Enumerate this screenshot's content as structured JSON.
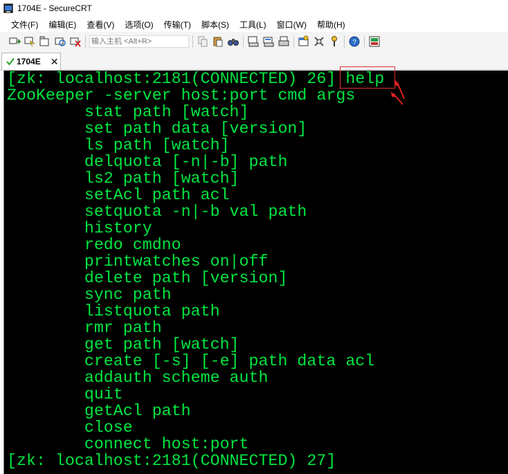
{
  "window": {
    "title": "1704E - SecureCRT"
  },
  "menu": [
    "文件(F)",
    "编辑(E)",
    "查看(V)",
    "选项(O)",
    "传输(T)",
    "脚本(S)",
    "工具(L)",
    "窗口(W)",
    "帮助(H)"
  ],
  "toolbar": {
    "quick_connect_placeholder": "输入主机 <Alt+R>"
  },
  "tab": {
    "label": "1704E",
    "close": "✕"
  },
  "terminal": {
    "text_color": "#00e640",
    "lines": [
      "[zk: localhost:2181(CONNECTED) 26] help",
      "ZooKeeper -server host:port cmd args",
      "        stat path [watch]",
      "        set path data [version]",
      "        ls path [watch]",
      "        delquota [-n|-b] path",
      "        ls2 path [watch]",
      "        setAcl path acl",
      "        setquota -n|-b val path",
      "        history",
      "        redo cmdno",
      "        printwatches on|off",
      "        delete path [version]",
      "        sync path",
      "        listquota path",
      "        rmr path",
      "        get path [watch]",
      "        create [-s] [-e] path data acl",
      "        addauth scheme auth",
      "        quit",
      "        getAcl path",
      "        close",
      "        connect host:port",
      "[zk: localhost:2181(CONNECTED) 27]"
    ]
  }
}
